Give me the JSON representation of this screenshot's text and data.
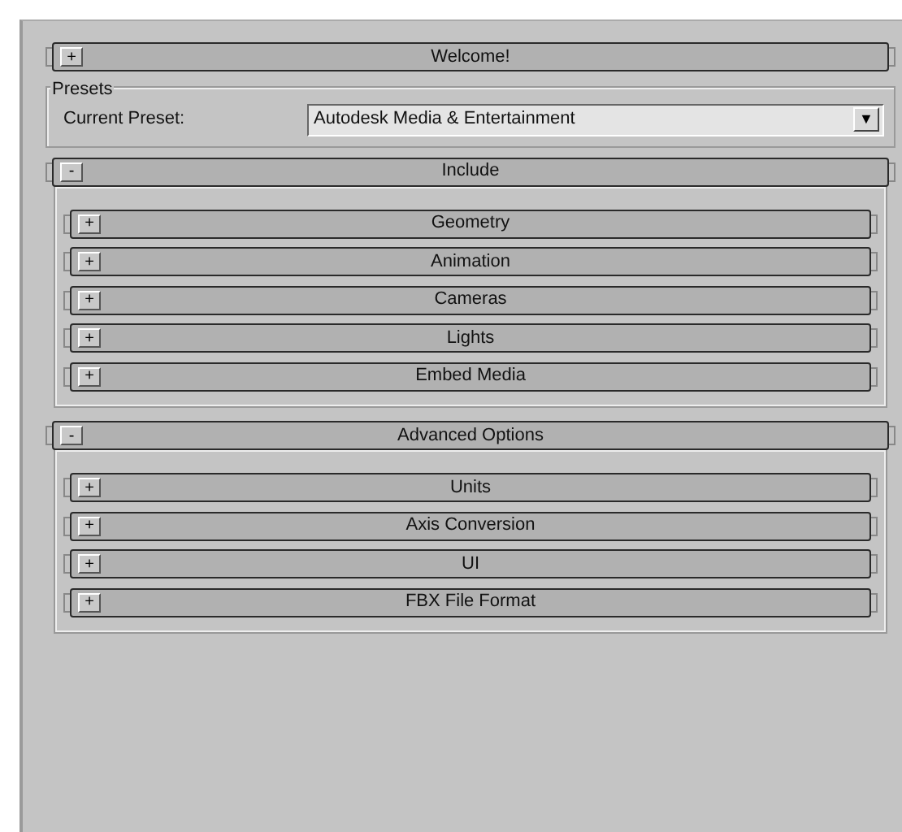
{
  "rollouts": [
    {
      "toggle": "+",
      "title": "Welcome!"
    },
    {
      "kind": "group",
      "title": "Presets",
      "label": "Current Preset:",
      "value": "Autodesk Media & Entertainment",
      "dropdown": "▼"
    },
    {
      "toggle": "-",
      "title": "Include",
      "children": [
        {
          "toggle": "+",
          "title": "Geometry"
        },
        {
          "toggle": "+",
          "title": "Animation"
        },
        {
          "toggle": "+",
          "title": "Cameras"
        },
        {
          "toggle": "+",
          "title": "Lights"
        },
        {
          "toggle": "+",
          "title": "Embed Media"
        }
      ]
    },
    {
      "toggle": "-",
      "title": "Advanced Options",
      "children": [
        {
          "toggle": "+",
          "title": "Units"
        },
        {
          "toggle": "+",
          "title": "Axis Conversion"
        },
        {
          "toggle": "+",
          "title": "UI"
        },
        {
          "toggle": "+",
          "title": "FBX File Format"
        }
      ]
    }
  ]
}
